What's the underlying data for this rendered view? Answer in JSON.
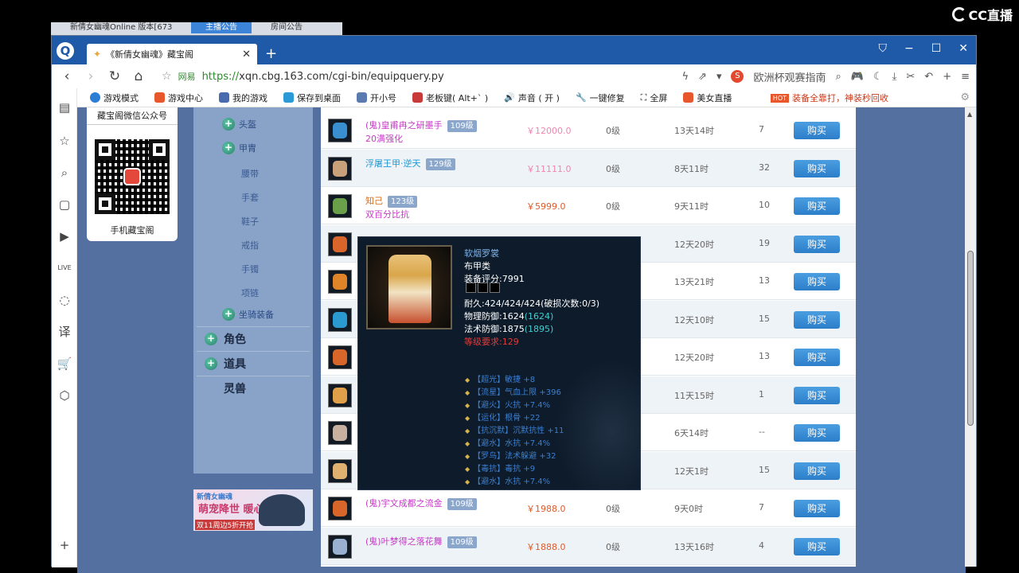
{
  "overlay": {
    "brand": "CC直播"
  },
  "background_windows": {
    "tab1": "新倩女幽魂Online 版本[673",
    "tab2": "主播公告",
    "tab3": "房间公告"
  },
  "browser": {
    "tab_title": "《新倩女幽魂》藏宝阁",
    "site_label": "网易",
    "url_proto": "https://",
    "url_rest": "xqn.cbg.163.com/cgi-bin/equipquery.py",
    "search_hint": "欧洲杯观赛指南"
  },
  "bookmarks": [
    "游戏模式",
    "游戏中心",
    "我的游戏",
    "保存到桌面",
    "开小号",
    "老板键( Alt+` )",
    "声音 ( 开 )",
    "一键修复",
    "全屏",
    "美女直播"
  ],
  "bookmark_promo": "装备全靠打，神装秒回收",
  "qr": {
    "top_label": "藏宝阁微信公众号",
    "bottom_label": "手机藏宝阁"
  },
  "cat_nav": {
    "subs": [
      "头盔",
      "甲胄"
    ],
    "leaves": [
      "腰带",
      "手套",
      "鞋子",
      "戒指",
      "手镯",
      "项链"
    ],
    "mount": "坐骑装备",
    "mains": [
      "角色",
      "道具",
      "灵兽"
    ]
  },
  "ad": {
    "t1": "新倩女幽魂",
    "t2": "萌宠降世 暖心陪伴",
    "t3": "双11周边5折开抢"
  },
  "listing": {
    "buy_label": "购买",
    "rows": [
      {
        "name": "(鬼)皇甫冉之研墨手",
        "level": "109级",
        "sub": "20满强化",
        "price": "￥12000.0",
        "fee": "0级",
        "time": "13天14时",
        "count": "7",
        "glyph": "#3a8fd0",
        "color": "pink"
      },
      {
        "name": "浮屠王甲·逆天",
        "level": "129级",
        "sub": "",
        "price": "￥11111.0",
        "fee": "0级",
        "time": "8天11时",
        "count": "32",
        "glyph": "#c8a07a",
        "color": "cyan"
      },
      {
        "name": "知己",
        "level": "123级",
        "sub": "双百分比抗",
        "price": "￥5999.0",
        "fee": "0级",
        "time": "9天11时",
        "count": "10",
        "glyph": "#6aa04a",
        "color": "orange"
      },
      {
        "name": "",
        "level": "",
        "sub": "",
        "price": "",
        "fee": "",
        "time": "12天20时",
        "count": "19",
        "glyph": "#d8652a",
        "color": "pink"
      },
      {
        "name": "",
        "level": "",
        "sub": "",
        "price": "",
        "fee": "",
        "time": "13天21时",
        "count": "13",
        "glyph": "#e0842a",
        "color": "pink"
      },
      {
        "name": "",
        "level": "",
        "sub": "",
        "price": "",
        "fee": "",
        "time": "12天10时",
        "count": "15",
        "glyph": "#2a9ad0",
        "color": "pink"
      },
      {
        "name": "",
        "level": "",
        "sub": "",
        "price": "",
        "fee": "",
        "time": "12天20时",
        "count": "13",
        "glyph": "#d8652a",
        "color": "pink"
      },
      {
        "name": "",
        "level": "",
        "sub": "",
        "price": "",
        "fee": "",
        "time": "11天15时",
        "count": "1",
        "glyph": "#e0a04a",
        "color": "pink"
      },
      {
        "name": "",
        "level": "",
        "sub": "",
        "price": "",
        "fee": "",
        "time": "6天14时",
        "count": "--",
        "glyph": "#c8b0a0",
        "color": "pink"
      },
      {
        "name": "",
        "level": "",
        "sub": "",
        "price": "",
        "fee": "",
        "time": "12天1时",
        "count": "15",
        "glyph": "#e0b070",
        "color": "pink"
      },
      {
        "name": "(鬼)宇文成都之流金",
        "level": "109级",
        "sub": "",
        "price": "￥1988.0",
        "fee": "0级",
        "time": "9天0时",
        "count": "7",
        "glyph": "#d8652a",
        "color": "pink"
      },
      {
        "name": "(鬼)叶梦得之落花舞",
        "level": "109级",
        "sub": "",
        "price": "￥1888.0",
        "fee": "0级",
        "time": "13天16时",
        "count": "4",
        "glyph": "#9ab0d0",
        "color": "pink"
      }
    ]
  },
  "tooltip": {
    "name": "软烟罗裳",
    "type": "布甲类",
    "score": "装备评分:7991",
    "durability": "耐久:424/424/424(破损次数:0/3)",
    "phys_def": "物理防御:1624",
    "phys_def_hl": "(1624)",
    "mag_def": "法术防御:1875",
    "mag_def_hl": "(1895)",
    "requirement": "等级要求:129",
    "attrs": [
      "【超光】敏捷 +8",
      "【流星】气血上限 +396",
      "【避火】火抗 +7.4%",
      "【运化】根骨 +22",
      "【抗沉默】沉默抗性 +11",
      "【避水】水抗 +7.4%",
      "【罗鸟】法术躲避 +32",
      "【毒抗】毒抗 +9",
      "【避水】水抗 +7.4%"
    ]
  }
}
